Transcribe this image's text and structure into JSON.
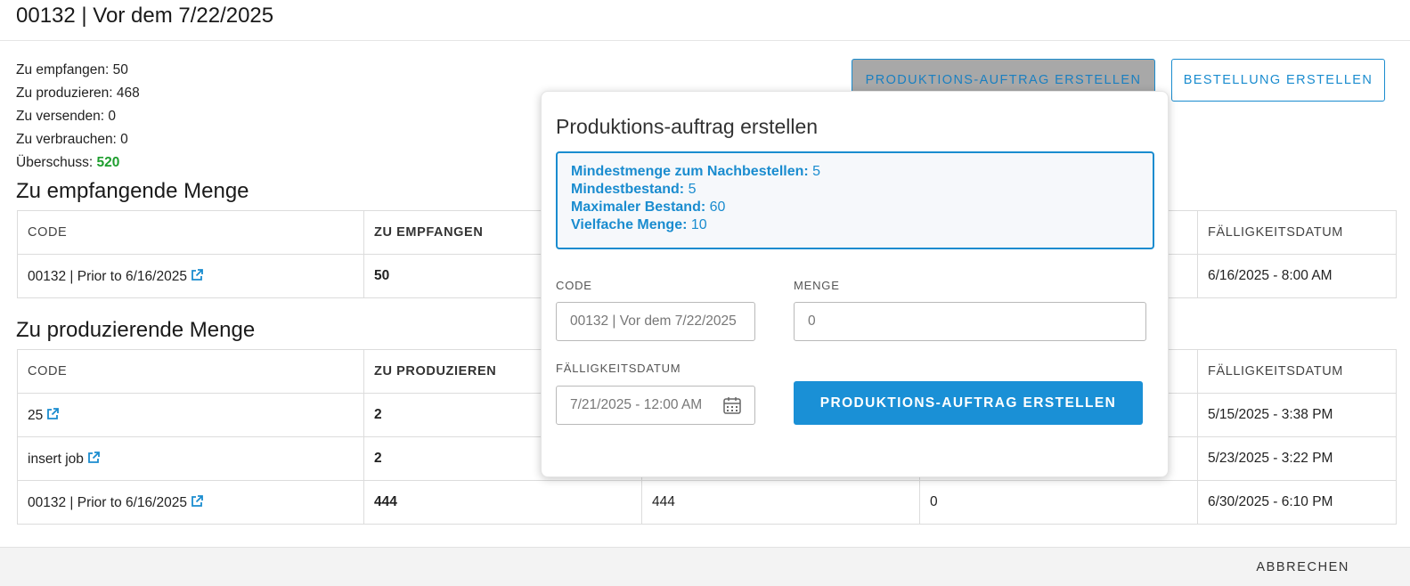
{
  "page": {
    "title": "00132 | Vor dem 7/22/2025"
  },
  "summary": {
    "to_receive": "Zu empfangen: 50",
    "to_produce": "Zu produzieren: 468",
    "to_ship": "Zu versenden: 0",
    "to_consume": "Zu verbrauchen: 0",
    "surplus_label": "Überschuss: ",
    "surplus_value": "520"
  },
  "buttons": {
    "create_production_order": "PRODUKTIONS-AUFTRAG ERSTELLEN",
    "create_order": "BESTELLUNG ERSTELLEN",
    "cancel": "ABBRECHEN"
  },
  "receive_section": {
    "title": "Zu empfangende Menge",
    "headers": {
      "code": "CODE",
      "qty": "ZU EMPFANGEN",
      "due": "FÄLLIGKEITSDATUM"
    },
    "rows": [
      {
        "code": "00132 | Prior to 6/16/2025",
        "qty": "50",
        "due": "6/16/2025 - 8:00 AM"
      }
    ]
  },
  "produce_section": {
    "title": "Zu produzierende Menge",
    "headers": {
      "code": "CODE",
      "qty": "ZU PRODUZIEREN",
      "due": "FÄLLIGKEITSDATUM"
    },
    "rows": [
      {
        "code": "25",
        "qty": "2",
        "col3": "",
        "col4": "",
        "due": "5/15/2025 - 3:38 PM"
      },
      {
        "code": "insert job",
        "qty": "2",
        "col3": "",
        "col4": "",
        "due": "5/23/2025 - 3:22 PM"
      },
      {
        "code": "00132 | Prior to 6/16/2025",
        "qty": "444",
        "col3": "444",
        "col4": "0",
        "due": "6/30/2025 - 6:10 PM"
      }
    ]
  },
  "popup": {
    "title": "Produktions-auftrag erstellen",
    "info": {
      "min_reorder_label": "Mindestmenge zum Nachbestellen:",
      "min_reorder_value": " 5",
      "min_stock_label": "Mindestbestand:",
      "min_stock_value": " 5",
      "max_stock_label": "Maximaler Bestand:",
      "max_stock_value": " 60",
      "multiple_label": "Vielfache Menge:",
      "multiple_value": " 10"
    },
    "code_label": "CODE",
    "code_value": "00132 | Vor dem 7/22/2025",
    "qty_label": "MENGE",
    "qty_value": "0",
    "due_label": "FÄLLIGKEITSDATUM",
    "due_value": "7/21/2025 - 12:00 AM",
    "submit": "PRODUKTIONS-AUFTRAG ERSTELLEN"
  },
  "colors": {
    "accent": "#1a8ccf",
    "surplus": "#1e9e2e"
  }
}
